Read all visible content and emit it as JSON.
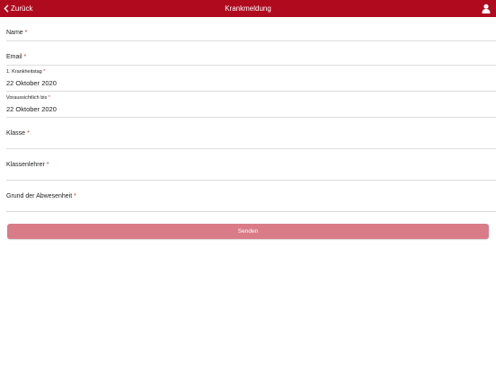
{
  "navbar": {
    "back_label": "Zurück",
    "title": "Krankmeldung",
    "accent": "#b00a1e"
  },
  "form": {
    "required_mark": "*",
    "name_label": "Name",
    "email_label": "Email",
    "first_day_label": "1. Krankheitstag",
    "first_day_value": "22 Oktober 2020",
    "until_label": "Voraussichtlich bis",
    "until_value": "22 Oktober 2020",
    "class_label": "Klasse",
    "teacher_label": "Klassenlehrer",
    "reason_label": "Grund der Abwesenheit",
    "submit_label": "Senden",
    "submit_color": "#d97c87"
  }
}
